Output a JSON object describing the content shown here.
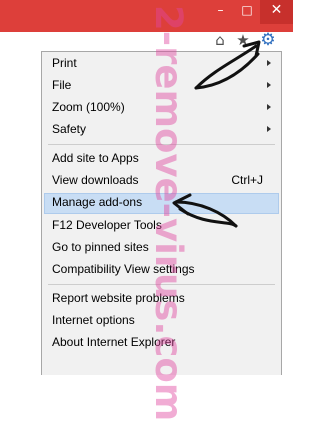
{
  "window": {
    "minimize_glyph": "–",
    "maximize_glyph": "□",
    "close_glyph": "✕"
  },
  "toolbar": {
    "icons": [
      "home-icon",
      "favorites-star-icon",
      "tools-gear-icon"
    ],
    "home_glyph": "⌂",
    "star_glyph": "★",
    "gear_glyph": "⚙"
  },
  "menu": {
    "items": [
      {
        "label": "Print"
      },
      {
        "label": "File"
      },
      {
        "label": "Zoom (100%)"
      },
      {
        "label": "Safety"
      },
      {
        "label": "Add site to Apps"
      },
      {
        "label": "View downloads",
        "shortcut": "Ctrl+J"
      },
      {
        "label": "Manage add-ons"
      },
      {
        "label": "F12 Developer Tools"
      },
      {
        "label": "Go to pinned sites"
      },
      {
        "label": "Compatibility View settings"
      },
      {
        "label": "Report website problems"
      },
      {
        "label": "Internet options"
      },
      {
        "label": "About Internet Explorer"
      }
    ]
  },
  "watermark": {
    "text": "2-remove-virus.com"
  },
  "colors": {
    "titlebar": "#dd3f3a",
    "close_button": "#c7302c",
    "menu_background": "#f1f1f1",
    "highlight": "#c8ddf4",
    "gear": "#2f6fbf",
    "watermark": "#e046a0"
  }
}
